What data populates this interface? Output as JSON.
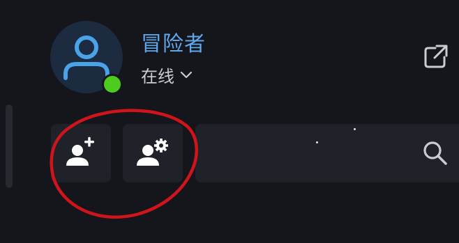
{
  "profile": {
    "username": "冒险者",
    "status": "在线",
    "status_color": "#4ccd1e",
    "avatar_icon": "user-icon"
  },
  "header": {
    "external_icon": "external-link-icon"
  },
  "actions": {
    "add_friend_icon": "add-user-icon",
    "manage_friend_icon": "user-settings-icon"
  },
  "search": {
    "value": "",
    "icon": "search-icon"
  },
  "colors": {
    "background": "#14161b",
    "panel": "#1f2228",
    "accent": "#5fa8ec",
    "annotation": "#d0141b"
  }
}
